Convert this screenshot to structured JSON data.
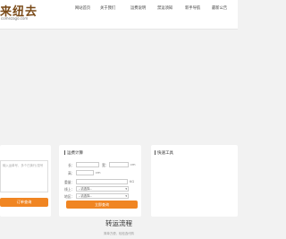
{
  "header": {
    "logo_text": "来纽去",
    "logo_sub": "comezago.com"
  },
  "nav": [
    {
      "label": "网站首页"
    },
    {
      "label": "关于我们"
    },
    {
      "label": "运费说明"
    },
    {
      "label": "禁运须知"
    },
    {
      "label": "新手导航"
    },
    {
      "label": "最新公告"
    }
  ],
  "tracking": {
    "placeholder": "输入运单号，多个已换行/逗号",
    "button_label": "订单查询"
  },
  "shipping_calc": {
    "title": "运费计算",
    "length_label": "长：",
    "width_label": "宽：",
    "height_label": "高：",
    "unit_cm": "cm",
    "weight_label": "重量：",
    "unit_kg": "KG",
    "route_label": "线上：",
    "route_value": "--请选择--",
    "region_label": "地区：",
    "region_value": "--请选择--",
    "button_label": "立即查询"
  },
  "quick_tools": {
    "title": "快速工具"
  },
  "section": {
    "title": "转运流程",
    "subtitle": "简单方便，轻松选代购"
  }
}
